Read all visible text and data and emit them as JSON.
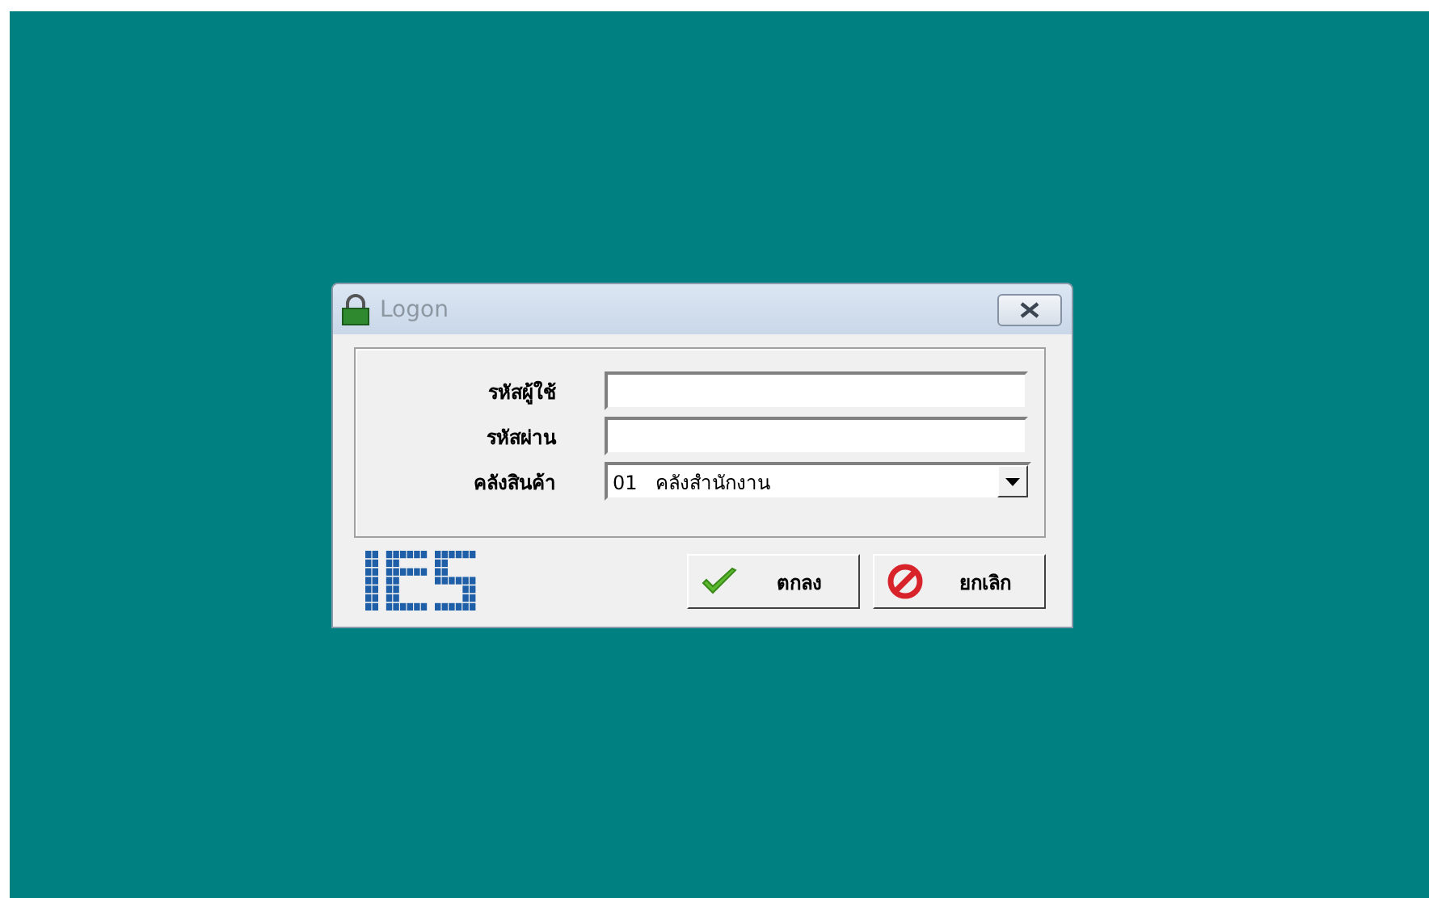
{
  "window": {
    "title": "Logon"
  },
  "fields": [
    {
      "label": "รหัสผู้ใช้",
      "kind": "text"
    },
    {
      "label": "รหัสผ่าน",
      "kind": "password"
    },
    {
      "label": "คลังสินค้า",
      "kind": "dropdown",
      "value": "01   คลังสำนักงาน"
    }
  ],
  "buttons": [
    {
      "label": "ตกลง",
      "kind": "ok"
    },
    {
      "label": "ยกเลิก",
      "kind": "cancel"
    }
  ]
}
